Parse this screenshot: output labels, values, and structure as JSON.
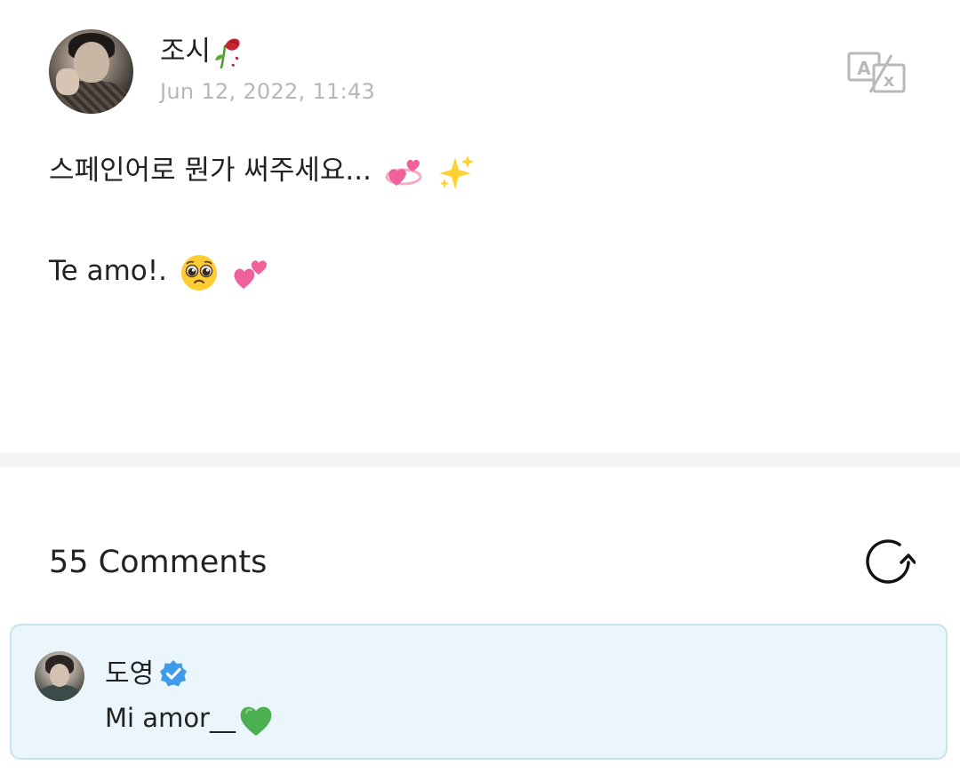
{
  "post": {
    "author": "조시",
    "author_emoji": "wilted-rose-icon",
    "date": "Jun 12, 2022, 11:43",
    "lines": [
      "스페인어로 뭔가 써주세요...",
      "Te amo!."
    ],
    "line_emojis": [
      [
        "revolving-hearts-icon",
        "sparkles-icon"
      ],
      [
        "pleading-face-icon",
        "two-hearts-icon"
      ]
    ],
    "translate_icon": "translate-icon"
  },
  "comments": {
    "title": "55 Comments",
    "refresh_icon": "refresh-icon",
    "pinned": {
      "author": "도영",
      "verified_icon": "verified-badge-icon",
      "text": "Mi amor__",
      "text_emoji": "green-heart-icon"
    }
  },
  "colors": {
    "text": "#222222",
    "date": "#b7b7b7",
    "divider": "#f3f4f6",
    "card_bg": "#eaf6fc",
    "card_border": "#c6e4ee",
    "verified": "#3d9be9",
    "heart_pink": "#f0609a",
    "green_heart": "#4caf50"
  }
}
